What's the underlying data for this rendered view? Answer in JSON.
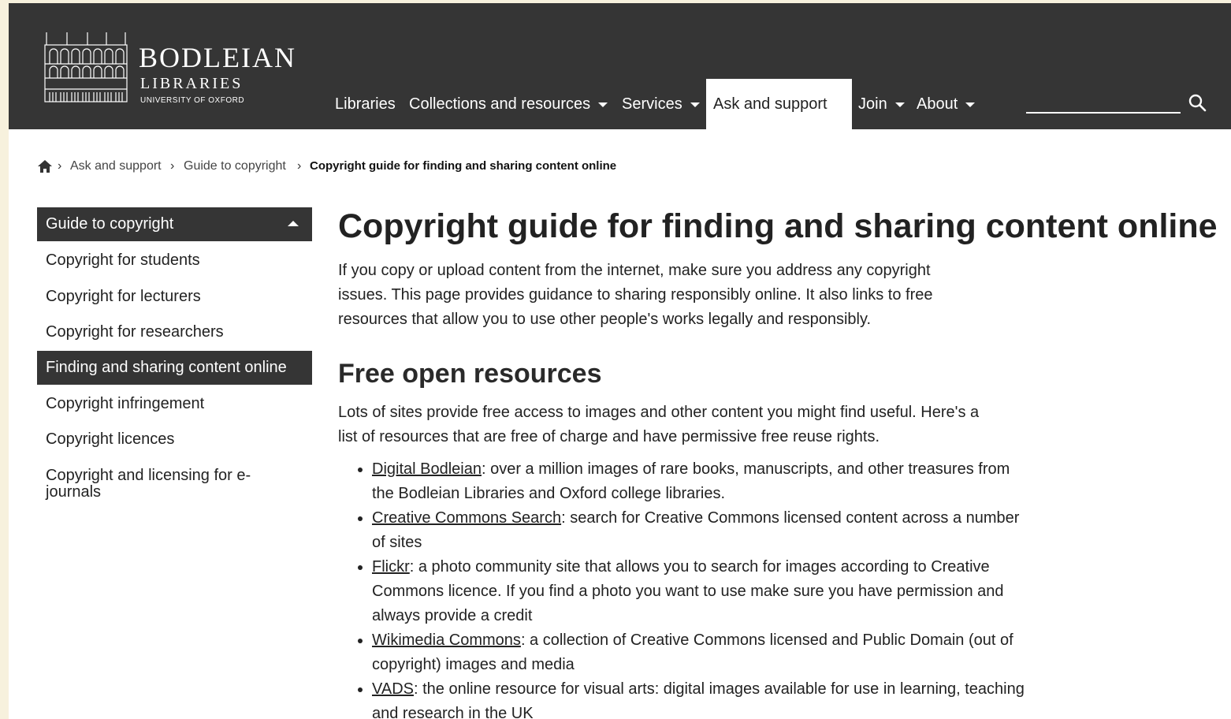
{
  "header": {
    "logo": {
      "name": "BODLEIAN",
      "subtitle": "LIBRARIES",
      "university": "UNIVERSITY OF OXFORD"
    },
    "nav": [
      {
        "label": "Libraries",
        "dropdown": false
      },
      {
        "label": "Collections and resources",
        "dropdown": true
      },
      {
        "label": "Services",
        "dropdown": true
      },
      {
        "label": "Ask and support",
        "dropdown": false,
        "active": true
      },
      {
        "label": "Join",
        "dropdown": true
      },
      {
        "label": "About",
        "dropdown": true
      }
    ],
    "search": {
      "placeholder": "",
      "icon": "search-icon"
    }
  },
  "breadcrumb": {
    "home_icon": "home-icon",
    "items": [
      "Ask and support",
      "Guide to copyright"
    ],
    "current": "Copyright guide for finding and sharing content online"
  },
  "sidebar": {
    "heading": "Guide to copyright",
    "items": [
      {
        "label": "Copyright for students"
      },
      {
        "label": "Copyright for lecturers"
      },
      {
        "label": "Copyright for researchers"
      },
      {
        "label": "Finding and sharing content online",
        "active": true
      },
      {
        "label": "Copyright infringement"
      },
      {
        "label": "Copyright licences"
      },
      {
        "label": "Copyright and licensing for e-journals"
      }
    ]
  },
  "main": {
    "title": "Copyright guide for finding and sharing content online",
    "intro": "If you copy or upload content from the internet, make sure you address any copyright issues. This page provides guidance to sharing responsibly online. It also links to free resources that allow you to use other people's works legally and responsibly.",
    "section": {
      "title": "Free open resources",
      "intro": "Lots of sites provide free access to images and other content you might find useful. Here's a list of resources that are free of charge and have permissive free reuse rights.",
      "resources": [
        {
          "link": "Digital Bodleian",
          "text": ": over a million images of rare books, manuscripts, and other treasures from the Bodleian Libraries and Oxford college libraries."
        },
        {
          "link": "Creative Commons Search",
          "text": ": search for Creative Commons licensed content across a number of sites"
        },
        {
          "link": "Flickr",
          "text": ": a photo community site that allows you to search for images according to Creative Commons licence. If you find a photo you want to use make sure you have permission and always provide a credit"
        },
        {
          "link": "Wikimedia Commons",
          "text": ": a collection of Creative Commons licensed and Public Domain (out of copyright) images and media"
        },
        {
          "link": "VADS",
          "text": ": the online resource for visual arts: digital images available for use in learning, teaching and research in the UK"
        }
      ]
    }
  },
  "colors": {
    "header_bg": "#353535",
    "page_bg": "#ffffff",
    "outer_bg": "#f7f1dd"
  }
}
